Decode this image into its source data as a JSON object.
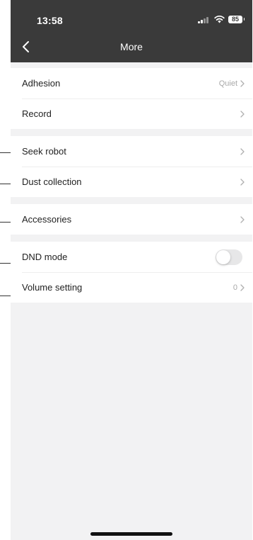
{
  "status_bar": {
    "time": "13:58",
    "battery": "85",
    "icons": [
      "signal-icon",
      "wifi-icon",
      "battery-icon"
    ]
  },
  "nav": {
    "title": "More",
    "back_icon": "chevron-left-icon"
  },
  "groups": [
    {
      "rows": [
        {
          "label": "Adhesion",
          "value": "Quiet",
          "control": "chevron"
        },
        {
          "label": "Record",
          "value": "",
          "control": "chevron"
        }
      ]
    },
    {
      "rows": [
        {
          "label": "Seek robot",
          "value": "",
          "control": "chevron"
        },
        {
          "label": "Dust collection",
          "value": "",
          "control": "chevron"
        }
      ]
    },
    {
      "rows": [
        {
          "label": "Accessories",
          "value": "",
          "control": "chevron"
        }
      ]
    },
    {
      "rows": [
        {
          "label": "DND mode",
          "value": "",
          "control": "toggle",
          "toggle_on": false
        },
        {
          "label": "Volume setting",
          "value": "0",
          "control": "chevron"
        }
      ]
    }
  ],
  "colors": {
    "header_bg": "#3a3a3a",
    "page_bg": "#f2f2f3",
    "row_bg": "#ffffff",
    "value_text": "#a8a8a8"
  }
}
